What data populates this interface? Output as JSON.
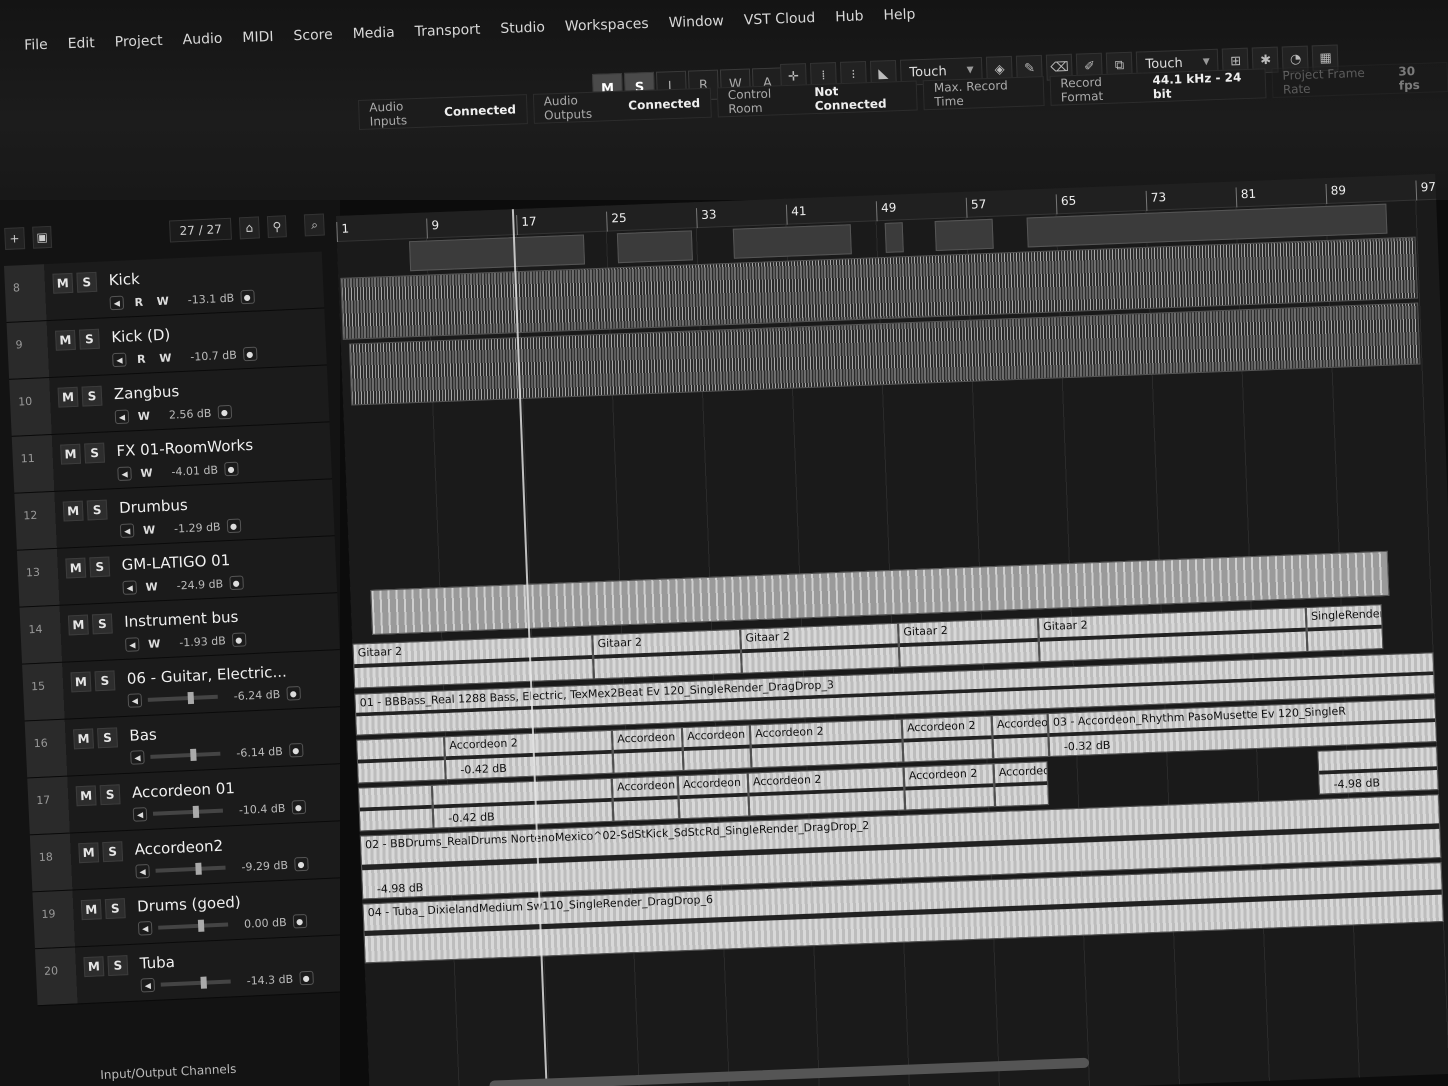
{
  "menu": [
    "File",
    "Edit",
    "Project",
    "Audio",
    "MIDI",
    "Score",
    "Media",
    "Transport",
    "Studio",
    "Workspaces",
    "Window",
    "VST Cloud",
    "Hub",
    "Help"
  ],
  "modes": {
    "m": "M",
    "s": "S",
    "l": "L",
    "r": "R",
    "w": "W",
    "a": "A"
  },
  "toolbar": {
    "automation_mode_left": "Touch",
    "automation_mode_right": "Touch"
  },
  "status": {
    "audio_inputs_label": "Audio Inputs",
    "audio_inputs_value": "Connected",
    "audio_outputs_label": "Audio Outputs",
    "audio_outputs_value": "Connected",
    "control_room_label": "Control Room",
    "control_room_value": "Not Connected",
    "max_record_label": "Max. Record Time",
    "record_format_label": "Record Format",
    "record_format_value": "44.1 kHz - 24 bit",
    "frame_rate_label": "Project Frame Rate",
    "frame_rate_value": "30 fps"
  },
  "tracklist": {
    "counter": "27 / 27",
    "footer": "Input/Output Channels",
    "tracks": [
      {
        "num": "8",
        "name": "Kick",
        "vol": "-13.1 dB",
        "btns": [
          "R",
          "W"
        ]
      },
      {
        "num": "9",
        "name": "Kick (D)",
        "vol": "-10.7 dB",
        "btns": [
          "R",
          "W"
        ]
      },
      {
        "num": "10",
        "name": "Zangbus",
        "vol": "2.56 dB",
        "btns": [
          "W"
        ]
      },
      {
        "num": "11",
        "name": "FX 01-RoomWorks",
        "vol": "-4.01 dB",
        "btns": [
          "W"
        ]
      },
      {
        "num": "12",
        "name": "Drumbus",
        "vol": "-1.29 dB",
        "btns": [
          "W"
        ]
      },
      {
        "num": "13",
        "name": "GM-LATIGO 01",
        "vol": "-24.9 dB",
        "btns": [
          "W"
        ]
      },
      {
        "num": "14",
        "name": "Instrument bus",
        "vol": "-1.93 dB",
        "btns": [
          "W"
        ]
      },
      {
        "num": "15",
        "name": "06 - Guitar, Electric...",
        "vol": "-6.24 dB",
        "btns": []
      },
      {
        "num": "16",
        "name": "Bas",
        "vol": "-6.14 dB",
        "btns": []
      },
      {
        "num": "17",
        "name": "Accordeon 01",
        "vol": "-10.4 dB",
        "btns": []
      },
      {
        "num": "18",
        "name": "Accordeon2",
        "vol": "-9.29 dB",
        "btns": []
      },
      {
        "num": "19",
        "name": "Drums (goed)",
        "vol": "0.00 dB",
        "btns": []
      },
      {
        "num": "20",
        "name": "Tuba",
        "vol": "-14.3 dB",
        "btns": []
      }
    ]
  },
  "ruler": {
    "bars": [
      "1",
      "9",
      "17",
      "25",
      "33",
      "41",
      "49",
      "57",
      "65",
      "73",
      "81",
      "89",
      "97"
    ]
  },
  "clips": {
    "gitaar": "Gitaar 2",
    "single_render": "SingleRender_",
    "bass": "01 - BBBass_Real 1288 Bass, Electric, TexMex2Beat Ev 120_SingleRender_DragDrop_3",
    "accordeon": "Accordeon",
    "accordeon2": "Accordeon 2",
    "accordeon_rhythm": "03 - Accordeon_Rhythm PasoMusette Ev 120_SingleR",
    "drums": "02 - BBDrums_RealDrums NortenoMexico^02-SdStKick_SdStcRd_SingleRender_DragDrop_2",
    "tuba": "04 - Tuba_ DixielandMedium Sw110_SingleRender_DragDrop_6",
    "vol_a": "-0.42 dB",
    "vol_b": "-0.42 dB",
    "vol_c": "-0.32 dB",
    "vol_d": "-4.98 dB",
    "vol_e": "-4.98 dB"
  }
}
